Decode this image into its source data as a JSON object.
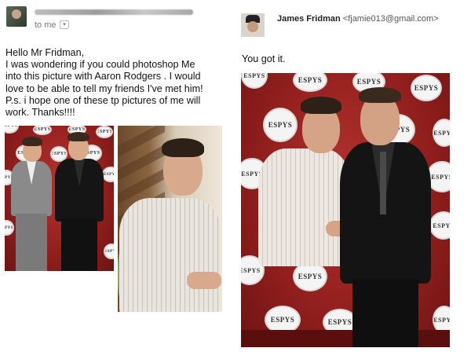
{
  "left_email": {
    "to_label": "to me",
    "caret": "▾",
    "message_lines": [
      "Hello Mr Fridman,",
      "I was wondering if you could photoshop Me",
      "into this picture with Aaron Rodgers . I would",
      "love to be able to tell my friends I've met him!",
      "P.s. i hope one of these tp pictures of me will",
      "work. Thanks!!!!"
    ]
  },
  "right_email": {
    "sender_name": "James Fridman",
    "sender_email": "<fjamie013@gmail.com>",
    "reply_text": "You got it."
  },
  "logo_text": "ESPYS",
  "colors": {
    "backdrop_red": "#9c2523",
    "suit_dark": "#151515",
    "suit_grey": "#7a7a7a",
    "plaid_shirt": "#e6e0da"
  }
}
